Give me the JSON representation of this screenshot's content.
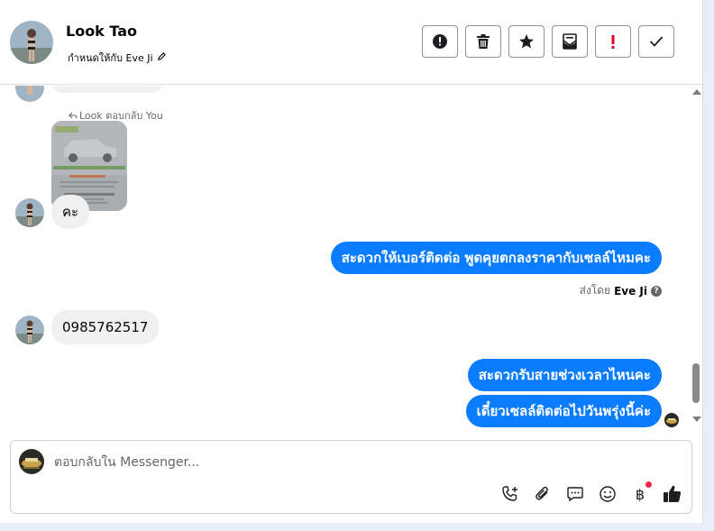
{
  "header": {
    "name": "Look Tao",
    "assigned_to": "กำหนดให้กับ Eve Ji"
  },
  "actions": [
    {
      "icon": "alert-circle-icon",
      "label": "spam"
    },
    {
      "icon": "trash-icon",
      "label": "delete"
    },
    {
      "icon": "star-icon",
      "label": "star"
    },
    {
      "icon": "envelope-icon",
      "label": "mark unread"
    },
    {
      "icon": "exclamation-icon",
      "label": "follow up"
    },
    {
      "icon": "check-icon",
      "label": "done"
    }
  ],
  "messages": {
    "reply_label": "Look ตอบกลับ You",
    "incoming_1": "คะ",
    "outgoing_1": "สะดวกให้เบอร์ติดต่อ พูดคุยตกลงราคากับเซลล์ไหมคะ",
    "sent_by_prefix": "ส่งโดย",
    "sent_by_name": "Eve Ji",
    "incoming_2": "0985762517",
    "outgoing_2": "สะดวกรับสายช่วงเวลาไหนคะ",
    "outgoing_3": "เดี๋ยวเซลล์ติดต่อไปวันพรุ่งนี้ค่ะ"
  },
  "composer": {
    "placeholder": "ตอบกลับใน Messenger...",
    "value": ""
  },
  "tools": [
    "phone-plus-icon",
    "paperclip-icon",
    "chat-bubble-icon",
    "emoji-icon",
    "baht-icon",
    "thumbs-up-icon"
  ],
  "colors": {
    "outgoing_bubble": "#0a7cff",
    "incoming_bubble": "#f0f0f0",
    "alert_red": "#e4002b"
  }
}
